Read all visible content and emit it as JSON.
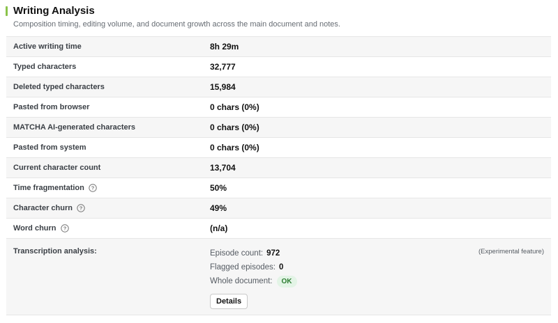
{
  "header": {
    "title": "Writing Analysis",
    "subtitle": "Composition timing, editing volume, and document growth across the main document and notes.",
    "accent_color": "#8bc34a"
  },
  "rows": [
    {
      "label": "Active writing time",
      "value": "8h 29m",
      "help": false
    },
    {
      "label": "Typed characters",
      "value": "32,777",
      "help": false
    },
    {
      "label": "Deleted typed characters",
      "value": "15,984",
      "help": false
    },
    {
      "label": "Pasted from browser",
      "value": "0 chars (0%)",
      "help": false
    },
    {
      "label": "MATCHA AI-generated characters",
      "value": "0 chars (0%)",
      "help": false
    },
    {
      "label": "Pasted from system",
      "value": "0 chars (0%)",
      "help": false
    },
    {
      "label": "Current character count",
      "value": "13,704",
      "help": false
    },
    {
      "label": "Time fragmentation",
      "value": "50%",
      "help": true,
      "help_icon": "question-circle-icon"
    },
    {
      "label": "Character churn",
      "value": "49%",
      "help": true,
      "help_icon": "question-circle-icon"
    },
    {
      "label": "Word churn",
      "value": "(n/a)",
      "help": true,
      "help_icon": "question-circle-icon"
    }
  ],
  "transcription": {
    "label": "Transcription analysis:",
    "episode_count_label": "Episode count:",
    "episode_count": "972",
    "flagged_label": "Flagged episodes:",
    "flagged": "0",
    "whole_doc_label": "Whole document:",
    "whole_doc_status": "OK",
    "details_button": "Details",
    "experimental_note": "(Experimental feature)"
  }
}
